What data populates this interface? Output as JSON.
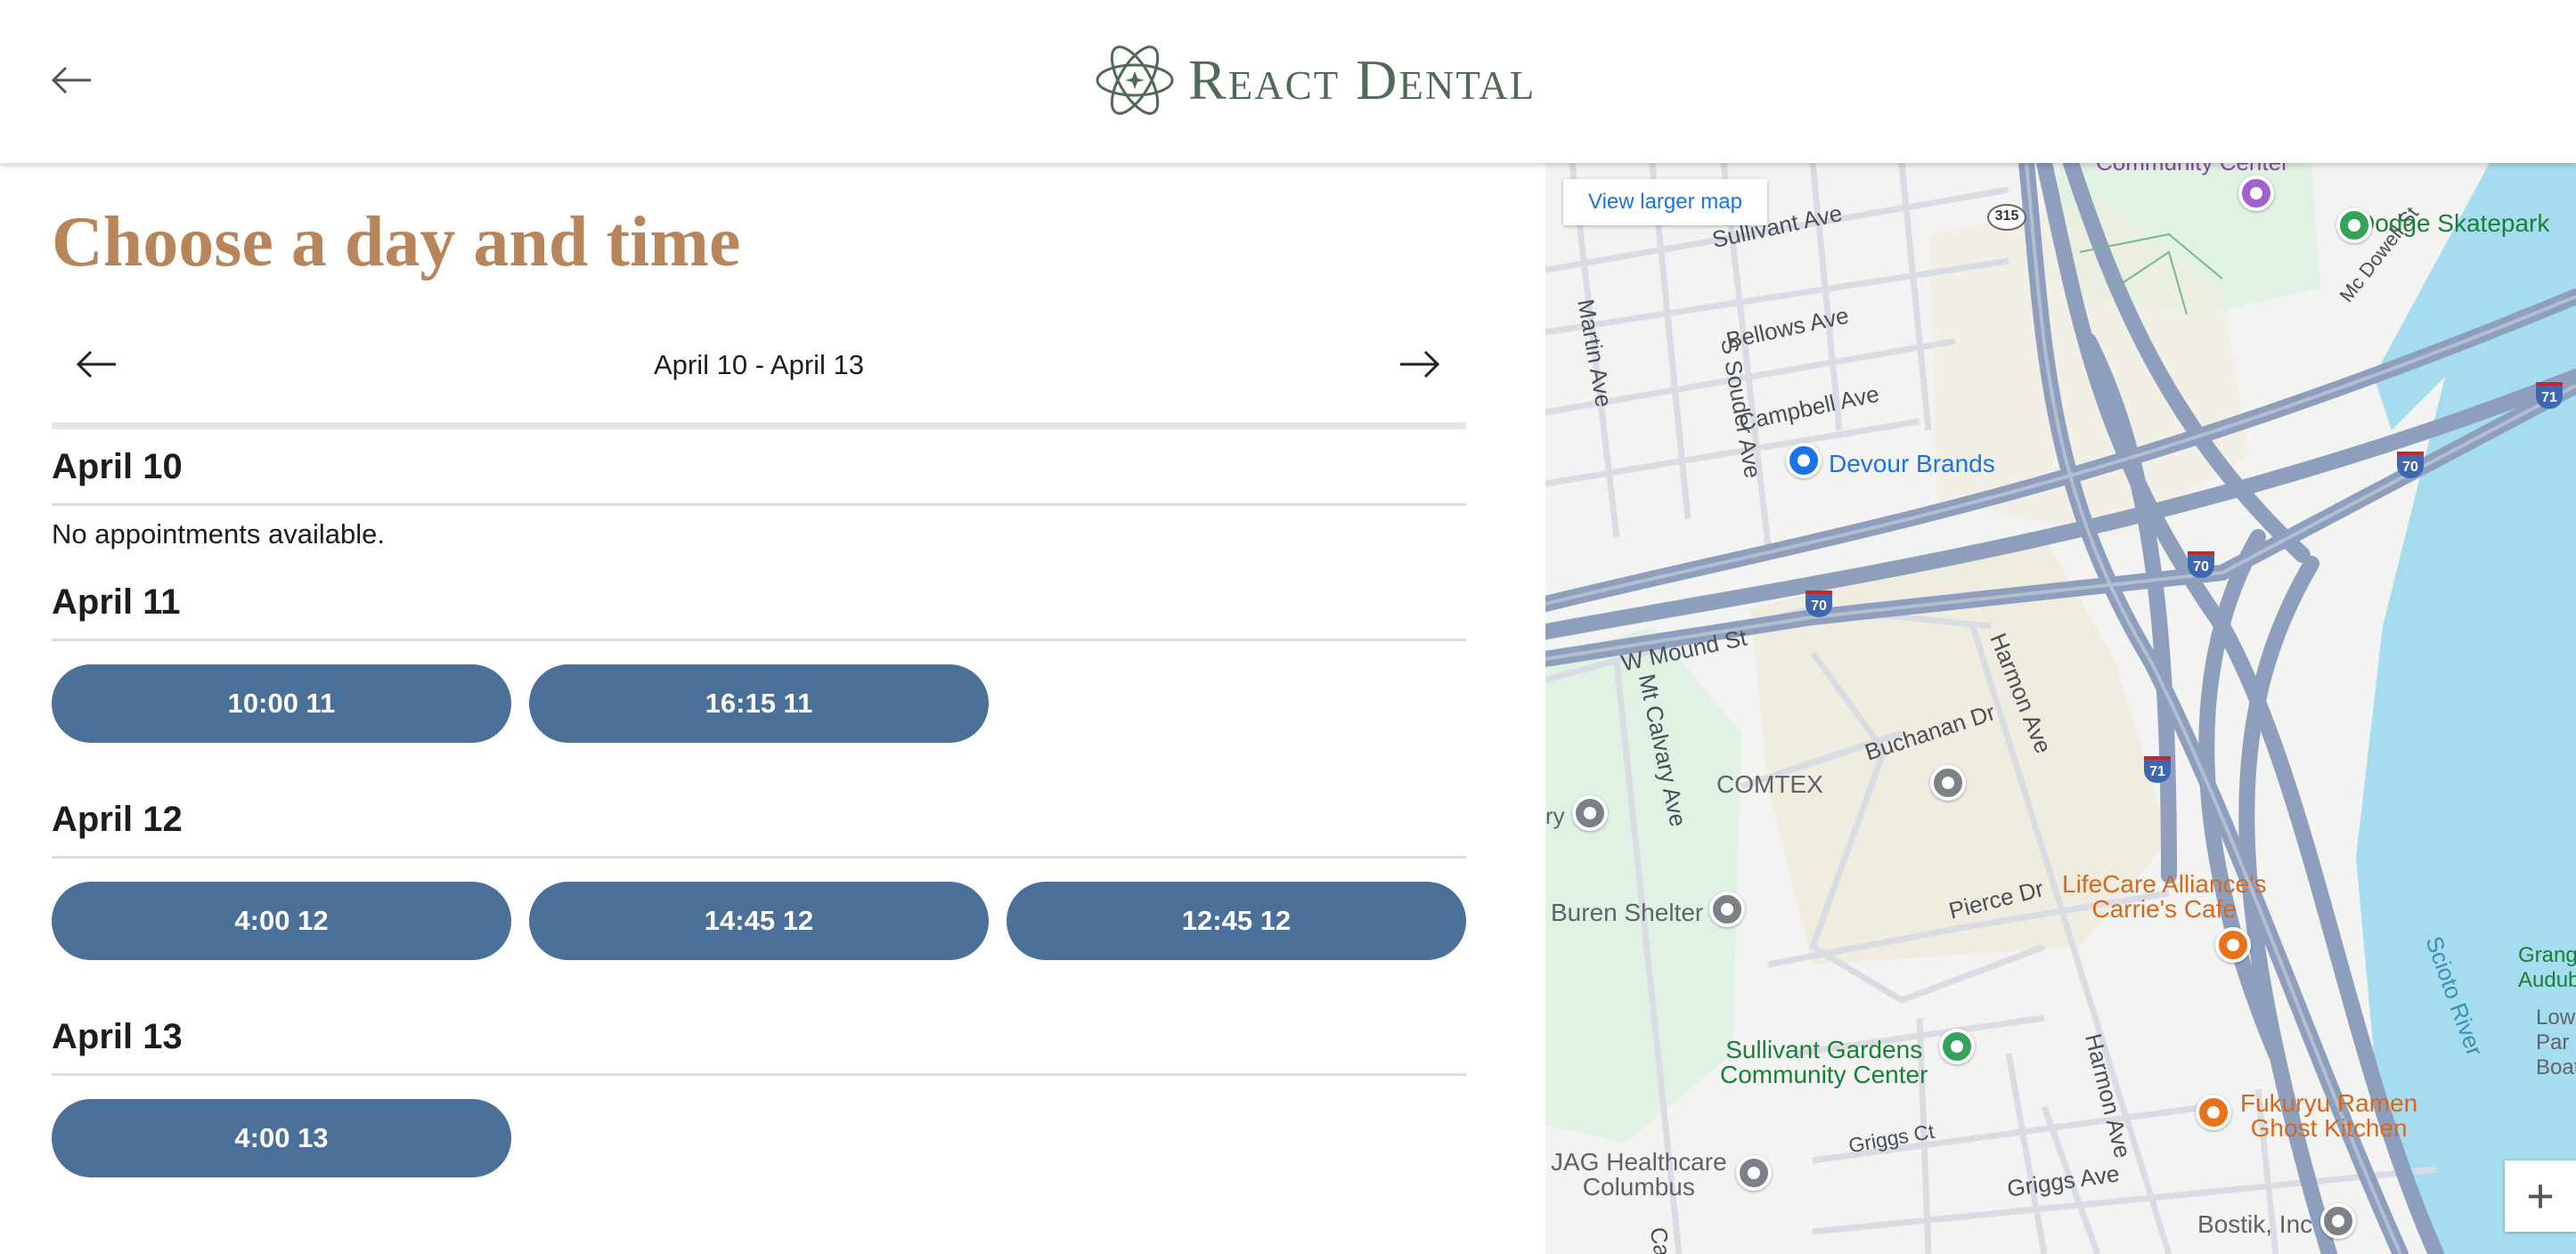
{
  "header": {
    "brand_name": "React Dental",
    "back_icon": "arrow-left-icon",
    "logo_icon": "atom-star-logo"
  },
  "main": {
    "title": "Choose a day and time",
    "week_range": "April 10 - April 13",
    "prev_icon": "arrow-left-icon",
    "next_icon": "arrow-right-icon",
    "days": [
      {
        "label": "April 10",
        "empty_message": "No appointments available.",
        "slots": []
      },
      {
        "label": "April 11",
        "slots": [
          "10:00 11",
          "16:15 11"
        ]
      },
      {
        "label": "April 12",
        "slots": [
          "4:00 12",
          "14:45 12",
          "12:45 12"
        ]
      },
      {
        "label": "April 13",
        "slots": [
          "4:00 13"
        ]
      }
    ]
  },
  "map": {
    "view_larger": "View larger map",
    "zoom_in": "+",
    "streets": [
      "Sullivant Ave",
      "Bellows Ave",
      "Campbell Ave",
      "Martin Ave",
      "S Souder Ave",
      "W Mound St",
      "Mt Calvary Ave",
      "Harmon Ave",
      "Buchanan Dr",
      "Pierce Dr",
      "Griggs Ct",
      "Griggs Ave",
      "Mc Dowell St",
      "Harmon Ave"
    ],
    "places": {
      "community_center_top": "Community Center",
      "dodge_skatepark": "Dodge Skatepark",
      "devour_brands": "Devour Brands",
      "comtex": "COMTEX",
      "lifecare_line1": "LifeCare Alliance's",
      "lifecare_line2": "Carrie's Cafe",
      "buren_shelter": "Buren Shelter",
      "sullivant_gardens_line1": "Sullivant Gardens",
      "sullivant_gardens_line2": "Community Center",
      "fukuryu_line1": "Fukuryu Ramen",
      "fukuryu_line2": "Ghost Kitchen",
      "jag_line1": "JAG Healthcare",
      "jag_line2": "Columbus",
      "bostik": "Bostik, Inc",
      "scioto_river": "Scioto River",
      "grange_line1": "Grange In",
      "grange_line2": "Audubon",
      "lower_line1": "Lowe",
      "lower_line2": "Par",
      "boat": "Boat",
      "partial_left": "ry",
      "partial_ca": "Ca"
    },
    "shields": [
      "315",
      "71",
      "70",
      "70",
      "70",
      "71"
    ],
    "colors": {
      "highway": "#8e9fbd",
      "water": "#a6dcef",
      "park": "#dff2e4",
      "sand": "#f1ece0",
      "land": "#f3f3f2"
    }
  },
  "colors": {
    "slot_bg": "#4a6f98",
    "title": "#b8855a",
    "brand": "#4f6a56"
  }
}
